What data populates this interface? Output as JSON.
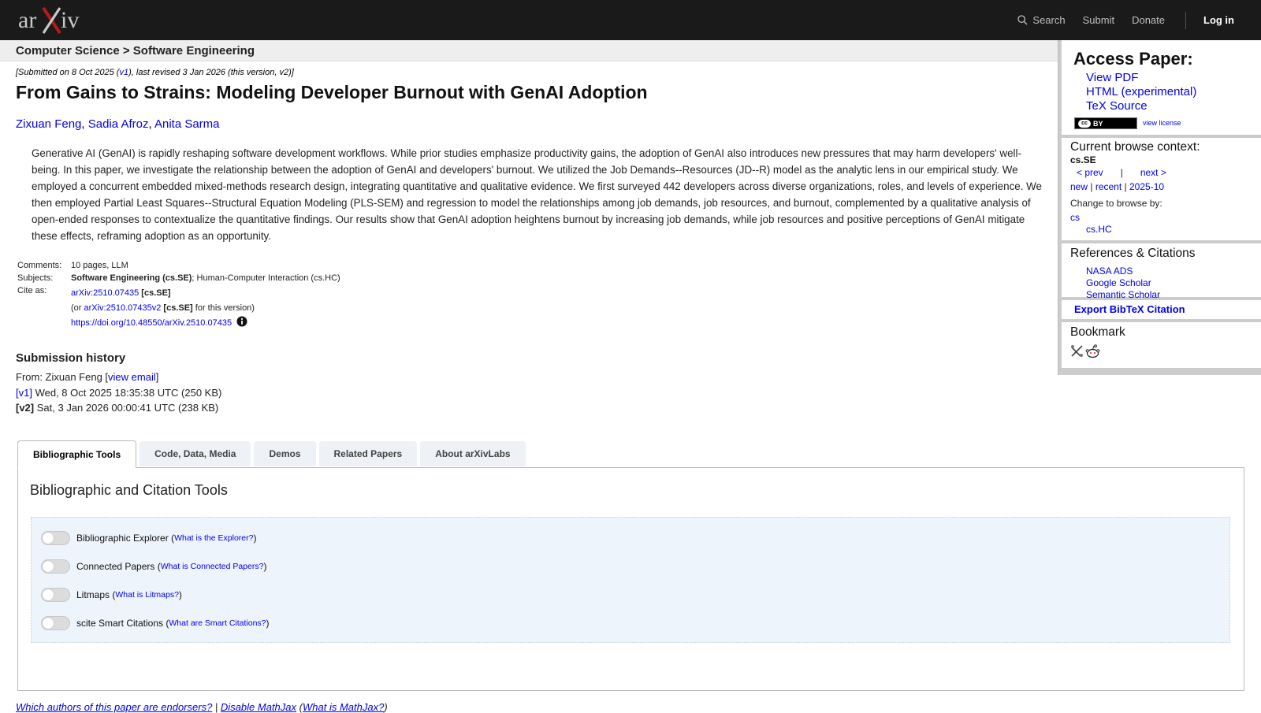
{
  "header": {
    "logo_text": "arXiv",
    "nav": {
      "search": "Search",
      "submit": "Submit",
      "donate": "Donate",
      "login": "Log in"
    }
  },
  "breadcrumb": "Computer Science > Software Engineering",
  "paper": {
    "dateline": {
      "prefix": "[Submitted on 8 Oct 2025 (",
      "v1": "v1",
      "suffix": "), last revised 3 Jan 2026 (this version, v2)]"
    },
    "title": "From Gains to Strains: Modeling Developer Burnout with GenAI Adoption",
    "authors": [
      "Zixuan Feng",
      "Sadia Afroz",
      "Anita Sarma"
    ],
    "abstract": "Generative AI (GenAI) is rapidly reshaping software development workflows. While prior studies emphasize productivity gains, the adoption of GenAI also introduces new pressures that may harm developers' well-being. In this paper, we investigate the relationship between the adoption of GenAI and developers' burnout. We utilized the Job Demands--Resources (JD--R) model as the analytic lens in our empirical study. We employed a concurrent embedded mixed-methods research design, integrating quantitative and qualitative evidence. We first surveyed 442 developers across diverse organizations, roles, and levels of experience. We then employed Partial Least Squares--Structural Equation Modeling (PLS-SEM) and regression to model the relationships among job demands, job resources, and burnout, complemented by a qualitative analysis of open-ended responses to contextualize the quantitative findings. Our results show that GenAI adoption heightens burnout by increasing job demands, while job resources and positive perceptions of GenAI mitigate these effects, reframing adoption as an opportunity.",
    "meta": {
      "comments_label": "Comments:",
      "comments": "10 pages, LLM",
      "subjects_label": "Subjects:",
      "subject_primary": "Software Engineering (cs.SE)",
      "subject_rest": "; Human-Computer Interaction (cs.HC)",
      "cite_label": "Cite as:",
      "cite_id": "arXiv:2510.07435",
      "cite_cat": "[cs.SE]",
      "or_open": "(or ",
      "cite_v2": "arXiv:2510.07435v2",
      "cite_v2_cat": "[cs.SE]",
      "or_close": " for this version)",
      "doi": "https://doi.org/10.48550/arXiv.2510.07435"
    },
    "history": {
      "title": "Submission history",
      "from_prefix": "From: Zixuan Feng [",
      "view_email": "view email",
      "from_suffix": "]",
      "v1_label": "[v1]",
      "v1_text": " Wed, 8 Oct 2025 18:35:38 UTC (250 KB)",
      "v2_label": "[v2]",
      "v2_text": " Sat, 3 Jan 2026 00:00:41 UTC (238 KB)"
    }
  },
  "tabs": [
    "Bibliographic Tools",
    "Code, Data, Media",
    "Demos",
    "Related Papers",
    "About arXivLabs"
  ],
  "tools": {
    "heading": "Bibliographic and Citation Tools",
    "items": [
      {
        "label": "Bibliographic Explorer",
        "link": "What is the Explorer?"
      },
      {
        "label": "Connected Papers",
        "link": "What is Connected Papers?"
      },
      {
        "label": "Litmaps",
        "link": "What is Litmaps?"
      },
      {
        "label": "scite Smart Citations",
        "link": "What are Smart Citations?"
      }
    ]
  },
  "footer": {
    "endorsers": "Which authors of this paper are endorsers?",
    "sep": " | ",
    "mathjax": "Disable MathJax",
    "what_mathjax": "What is MathJax?"
  },
  "sidebar": {
    "access_title": "Access Paper:",
    "access_links": [
      "View PDF",
      "HTML (experimental)",
      "TeX Source"
    ],
    "cc_badge": "BY",
    "cc_mark": "cc",
    "license": "view license",
    "browse_context": "Current browse context:",
    "category": "cs.SE",
    "prev": "< prev",
    "bar": "|",
    "next": "next >",
    "new": "new",
    "recent": "recent",
    "month": "2025-10",
    "change_by": "Change to browse by:",
    "cs": "cs",
    "cs_hc": "cs.HC",
    "refs_title": "References & Citations",
    "refs_links": [
      "NASA ADS",
      "Google Scholar",
      "Semantic Scholar"
    ],
    "bibtex": "Export BibTeX Citation",
    "bookmark": "Bookmark"
  }
}
